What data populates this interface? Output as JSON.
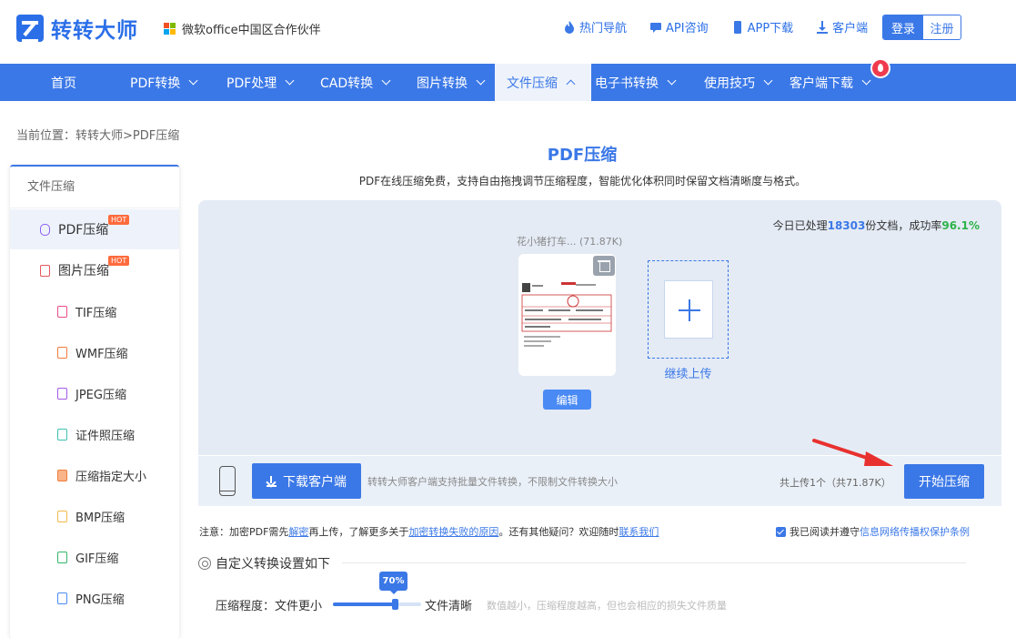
{
  "header": {
    "brand": "转转大师",
    "partner": "微软office中国区合作伙伴",
    "links": [
      {
        "label": "热门导航",
        "icon": "fire-icon"
      },
      {
        "label": "API咨询",
        "icon": "chat-icon"
      },
      {
        "label": "APP下载",
        "icon": "phone-icon"
      },
      {
        "label": "客户端",
        "icon": "download-icon"
      }
    ],
    "login": "登录",
    "register": "注册"
  },
  "nav": {
    "items": [
      {
        "label": "首页"
      },
      {
        "label": "PDF转换"
      },
      {
        "label": "PDF处理"
      },
      {
        "label": "CAD转换"
      },
      {
        "label": "图片转换"
      },
      {
        "label": "文件压缩"
      },
      {
        "label": "电子书转换"
      },
      {
        "label": "使用技巧"
      },
      {
        "label": "客户端下载"
      }
    ],
    "active_index": 5
  },
  "breadcrumb": "当前位置：转转大师>PDF压缩",
  "sidebar": {
    "heading": "文件压缩",
    "hot": "HOT",
    "items": [
      {
        "label": "PDF压缩",
        "hot": true,
        "active": true
      },
      {
        "label": "图片压缩",
        "hot": true
      },
      {
        "label": "TIF压缩"
      },
      {
        "label": "WMF压缩"
      },
      {
        "label": "JPEG压缩"
      },
      {
        "label": "证件照压缩"
      },
      {
        "label": "压缩指定大小"
      },
      {
        "label": "BMP压缩"
      },
      {
        "label": "GIF压缩"
      },
      {
        "label": "PNG压缩"
      }
    ]
  },
  "main": {
    "title": "PDF压缩",
    "subtitle": "PDF在线压缩免费，支持自由拖拽调节压缩程度，智能优化体积同时保留文档清晰度与格式。",
    "stats": {
      "prefix": "今日已处理",
      "count": "18303",
      "mid": "份文档，成功率",
      "rate": "96.1%"
    },
    "file": {
      "name": "花小猪打车... (71.87K)",
      "edit": "编辑"
    },
    "add_more": "继续上传",
    "download_client": "下载客户端",
    "client_note": "转转大师客户端支持批量文件转换，不限制文件转换大小",
    "upload_count": "共上传1个（共71.87K）",
    "start": "开始压缩"
  },
  "notice": {
    "p1": "注意：加密PDF需先",
    "link1": "解密",
    "p2": "再上传，了解更多关于",
    "link2": "加密转换失败的原因",
    "p3": "。还有其他疑问？欢迎随时",
    "link3": "联系我们"
  },
  "agree": {
    "text": "我已阅读并遵守",
    "link": "信息网络传播权保护条例",
    "checked": true
  },
  "settings": {
    "heading": "自定义转换设置如下",
    "level_label": "压缩程度：",
    "left": "文件更小",
    "right": "文件清晰",
    "value": "70%",
    "fraction": 0.7,
    "hint": "数值越小，压缩程度越高，但也会相应的损失文件质量"
  },
  "colors": {
    "primary": "#3b78e7",
    "success": "#2db34a",
    "hot": "#ff6b3d",
    "arrow": "#e8312f"
  }
}
